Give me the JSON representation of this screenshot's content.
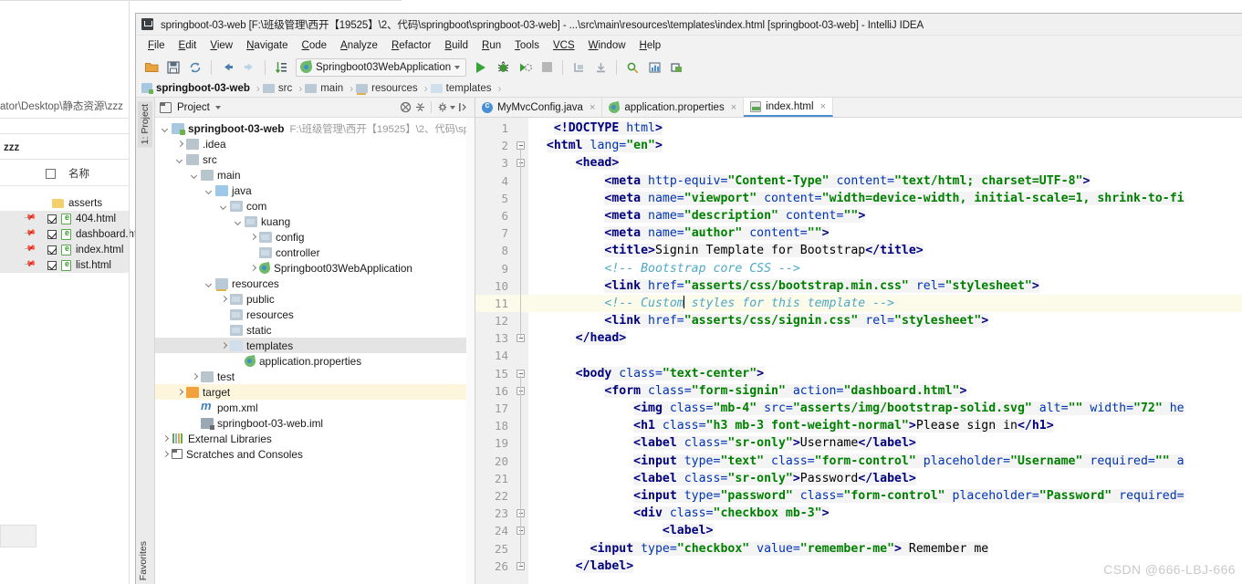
{
  "explorer": {
    "path": "ator\\Desktop\\静态资源\\zzz",
    "folder_label": "zzz",
    "column_header": "名称",
    "rows": [
      {
        "name": "asserts",
        "type": "folder",
        "checked": false,
        "selected": false
      },
      {
        "name": "404.html",
        "type": "html",
        "checked": true,
        "selected": true
      },
      {
        "name": "dashboard.ht",
        "type": "html",
        "checked": true,
        "selected": true
      },
      {
        "name": "index.html",
        "type": "html",
        "checked": true,
        "selected": true
      },
      {
        "name": "list.html",
        "type": "html",
        "checked": true,
        "selected": true
      }
    ]
  },
  "window": {
    "title": "springboot-03-web [F:\\班级管理\\西开【19525】\\2、代码\\springboot\\springboot-03-web] - ...\\src\\main\\resources\\templates\\index.html [springboot-03-web] - IntelliJ IDEA",
    "app_icon": "idea-logo-icon"
  },
  "menu": {
    "items": [
      {
        "m": "F",
        "rest": "ile"
      },
      {
        "m": "E",
        "rest": "dit"
      },
      {
        "m": "V",
        "rest": "iew"
      },
      {
        "m": "N",
        "rest": "avigate"
      },
      {
        "m": "C",
        "rest": "ode"
      },
      {
        "m": "A",
        "rest": "nalyze"
      },
      {
        "m": "R",
        "rest": "efactor"
      },
      {
        "m": "B",
        "rest": "uild"
      },
      {
        "m": "R",
        "rest": "un"
      },
      {
        "m": "T",
        "rest": "ools"
      },
      {
        "m": "VCS",
        "rest": ""
      },
      {
        "m": "W",
        "rest": "indow"
      },
      {
        "m": "H",
        "rest": "elp"
      }
    ]
  },
  "toolbar": {
    "run_config": "Springboot03WebApplication",
    "icons": [
      "open-folder-icon",
      "save-all-icon",
      "sync-icon",
      "back-arrow-icon",
      "forward-arrow-icon",
      "sort-icon",
      "run-icon",
      "debug-icon",
      "run-coverage-icon",
      "stop-icon",
      "build-project-icon",
      "build-module-icon",
      "search-everywhere-icon",
      "settings-icon",
      "sdk-manager-icon"
    ]
  },
  "breadcrumb": {
    "items": [
      {
        "label": "springboot-03-web",
        "icon": "module-icon"
      },
      {
        "label": "src",
        "icon": "folder-icon"
      },
      {
        "label": "main",
        "icon": "folder-icon"
      },
      {
        "label": "resources",
        "icon": "resources-folder-icon"
      },
      {
        "label": "templates",
        "icon": "templates-folder-icon"
      }
    ]
  },
  "left_rail": {
    "top_label": "1: Project",
    "bottom_label": "Favorites"
  },
  "project_panel": {
    "title": "Project",
    "buttons": [
      "collapse-all-icon",
      "expand-icon",
      "settings-gear-icon",
      "hide-panel-icon"
    ],
    "tree": [
      {
        "indent": 0,
        "arrow": "down",
        "icon": "module-root-icon",
        "name": "springboot-03-web",
        "bold": true,
        "path": "F:\\班级管理\\西开【19525】\\2、代码\\springboot"
      },
      {
        "indent": 1,
        "arrow": "right",
        "icon": "folder-grey-icon",
        "name": ".idea"
      },
      {
        "indent": 1,
        "arrow": "down",
        "icon": "folder-grey-icon",
        "name": "src"
      },
      {
        "indent": 2,
        "arrow": "down",
        "icon": "folder-grey-icon",
        "name": "main"
      },
      {
        "indent": 3,
        "arrow": "down",
        "icon": "source-folder-icon",
        "name": "java"
      },
      {
        "indent": 4,
        "arrow": "down",
        "icon": "package-icon",
        "name": "com"
      },
      {
        "indent": 5,
        "arrow": "down",
        "icon": "package-icon",
        "name": "kuang"
      },
      {
        "indent": 6,
        "arrow": "right",
        "icon": "package-icon",
        "name": "config"
      },
      {
        "indent": 6,
        "arrow": "none",
        "icon": "package-icon",
        "name": "controller"
      },
      {
        "indent": 6,
        "arrow": "right",
        "icon": "spring-class-icon",
        "name": "Springboot03WebApplication"
      },
      {
        "indent": 3,
        "arrow": "down",
        "icon": "resources-folder-icon",
        "name": "resources"
      },
      {
        "indent": 4,
        "arrow": "right",
        "icon": "package-icon",
        "name": "public"
      },
      {
        "indent": 4,
        "arrow": "none",
        "icon": "package-icon",
        "name": "resources"
      },
      {
        "indent": 4,
        "arrow": "none",
        "icon": "package-icon",
        "name": "static"
      },
      {
        "indent": 4,
        "arrow": "right",
        "icon": "templates-folder-icon",
        "name": "templates",
        "state": "selected"
      },
      {
        "indent": 5,
        "arrow": "none",
        "icon": "spring-props-icon",
        "name": "application.properties"
      },
      {
        "indent": 2,
        "arrow": "right",
        "icon": "folder-grey-icon",
        "name": "test"
      },
      {
        "indent": 1,
        "arrow": "right",
        "icon": "folder-orange-icon",
        "name": "target",
        "state": "highlighted"
      },
      {
        "indent": 2,
        "arrow": "none",
        "icon": "maven-icon",
        "name": "pom.xml"
      },
      {
        "indent": 2,
        "arrow": "none",
        "icon": "iml-icon",
        "name": "springboot-03-web.iml"
      },
      {
        "indent": 0,
        "arrow": "right",
        "icon": "libraries-icon",
        "name": "External Libraries"
      },
      {
        "indent": 0,
        "arrow": "right",
        "icon": "scratches-icon",
        "name": "Scratches and Consoles"
      }
    ]
  },
  "editor": {
    "tabs": [
      {
        "label": "MyMvcConfig.java",
        "icon": "java-class-icon",
        "active": false
      },
      {
        "label": "application.properties",
        "icon": "spring-props-icon",
        "active": false
      },
      {
        "label": "index.html",
        "icon": "html-file-icon",
        "active": true
      }
    ],
    "caret_line": 11,
    "first_line": 1,
    "last_line": 26,
    "fold_lines": [
      2,
      3,
      13,
      15,
      16,
      23,
      24,
      26
    ],
    "lines": [
      {
        "n": 1,
        "tokens": [
          {
            "t": "ind",
            "v": "   "
          },
          {
            "t": "tg",
            "v": "<!DOCTYPE "
          },
          {
            "t": "at",
            "v": "html"
          },
          {
            "t": "tg",
            "v": ">"
          }
        ]
      },
      {
        "n": 2,
        "tokens": [
          {
            "t": "ind",
            "v": "  "
          },
          {
            "t": "tg",
            "v": "<html "
          },
          {
            "t": "at",
            "v": "lang="
          },
          {
            "t": "vl",
            "v": "\"en\""
          },
          {
            "t": "tg",
            "v": ">"
          }
        ]
      },
      {
        "n": 3,
        "tokens": [
          {
            "t": "ind",
            "v": "      "
          },
          {
            "t": "tg",
            "v": "<head>"
          }
        ]
      },
      {
        "n": 4,
        "tokens": [
          {
            "t": "ind",
            "v": "          "
          },
          {
            "t": "tg",
            "v": "<meta "
          },
          {
            "t": "at",
            "v": "http-equiv="
          },
          {
            "t": "vl",
            "v": "\"Content-Type\""
          },
          {
            "t": "at",
            "v": " content="
          },
          {
            "t": "vl",
            "v": "\"text/html; charset=UTF-8\""
          },
          {
            "t": "tg",
            "v": ">"
          }
        ]
      },
      {
        "n": 5,
        "tokens": [
          {
            "t": "ind",
            "v": "          "
          },
          {
            "t": "tg",
            "v": "<meta "
          },
          {
            "t": "at",
            "v": "name="
          },
          {
            "t": "vl",
            "v": "\"viewport\""
          },
          {
            "t": "at",
            "v": " content="
          },
          {
            "t": "vl",
            "v": "\"width=device-width, initial-scale=1, shrink-to-fi"
          }
        ]
      },
      {
        "n": 6,
        "tokens": [
          {
            "t": "ind",
            "v": "          "
          },
          {
            "t": "tg",
            "v": "<meta "
          },
          {
            "t": "at",
            "v": "name="
          },
          {
            "t": "vl",
            "v": "\"description\""
          },
          {
            "t": "at",
            "v": " content="
          },
          {
            "t": "vl",
            "v": "\"\""
          },
          {
            "t": "tg",
            "v": ">"
          }
        ]
      },
      {
        "n": 7,
        "tokens": [
          {
            "t": "ind",
            "v": "          "
          },
          {
            "t": "tg",
            "v": "<meta "
          },
          {
            "t": "at",
            "v": "name="
          },
          {
            "t": "vl",
            "v": "\"author\""
          },
          {
            "t": "at",
            "v": " content="
          },
          {
            "t": "vl",
            "v": "\"\""
          },
          {
            "t": "tg",
            "v": ">"
          }
        ]
      },
      {
        "n": 8,
        "tokens": [
          {
            "t": "ind",
            "v": "          "
          },
          {
            "t": "tg",
            "v": "<title>"
          },
          {
            "t": "tx",
            "v": "Signin Template for Bootstrap"
          },
          {
            "t": "tg",
            "v": "</title>"
          }
        ]
      },
      {
        "n": 9,
        "tokens": [
          {
            "t": "ind",
            "v": "          "
          },
          {
            "t": "cm",
            "v": "<!-- Bootstrap core CSS -->"
          }
        ]
      },
      {
        "n": 10,
        "tokens": [
          {
            "t": "ind",
            "v": "          "
          },
          {
            "t": "tg",
            "v": "<link "
          },
          {
            "t": "at",
            "v": "href="
          },
          {
            "t": "vl",
            "v": "\"asserts/css/bootstrap.min.css\""
          },
          {
            "t": "at",
            "v": " rel="
          },
          {
            "t": "vl",
            "v": "\"stylesheet\""
          },
          {
            "t": "tg",
            "v": ">"
          }
        ]
      },
      {
        "n": 11,
        "tokens": [
          {
            "t": "ind",
            "v": "          "
          },
          {
            "t": "cm",
            "v": "<!-- Custom"
          },
          {
            "t": "caret",
            "v": ""
          },
          {
            "t": "cm",
            "v": " styles for this template -->"
          }
        ]
      },
      {
        "n": 12,
        "tokens": [
          {
            "t": "ind",
            "v": "          "
          },
          {
            "t": "tg",
            "v": "<link "
          },
          {
            "t": "at",
            "v": "href="
          },
          {
            "t": "vl",
            "v": "\"asserts/css/signin.css\""
          },
          {
            "t": "at",
            "v": " rel="
          },
          {
            "t": "vl",
            "v": "\"stylesheet\""
          },
          {
            "t": "tg",
            "v": ">"
          }
        ]
      },
      {
        "n": 13,
        "tokens": [
          {
            "t": "ind",
            "v": "      "
          },
          {
            "t": "tg",
            "v": "</head>"
          }
        ]
      },
      {
        "n": 14,
        "tokens": []
      },
      {
        "n": 15,
        "tokens": [
          {
            "t": "ind",
            "v": "      "
          },
          {
            "t": "tg",
            "v": "<body "
          },
          {
            "t": "at",
            "v": "class="
          },
          {
            "t": "vl",
            "v": "\"text-center\""
          },
          {
            "t": "tg",
            "v": ">"
          }
        ]
      },
      {
        "n": 16,
        "tokens": [
          {
            "t": "ind",
            "v": "          "
          },
          {
            "t": "tg",
            "v": "<form "
          },
          {
            "t": "at",
            "v": "class="
          },
          {
            "t": "vl",
            "v": "\"form-signin\""
          },
          {
            "t": "at",
            "v": " action="
          },
          {
            "t": "vl",
            "v": "\"dashboard.html\""
          },
          {
            "t": "tg",
            "v": ">"
          }
        ]
      },
      {
        "n": 17,
        "tokens": [
          {
            "t": "ind",
            "v": "              "
          },
          {
            "t": "tg",
            "v": "<img "
          },
          {
            "t": "at",
            "v": "class="
          },
          {
            "t": "vl",
            "v": "\"mb-4\""
          },
          {
            "t": "at",
            "v": " src="
          },
          {
            "t": "vl",
            "v": "\"asserts/img/bootstrap-solid.svg\""
          },
          {
            "t": "at",
            "v": " alt="
          },
          {
            "t": "vl",
            "v": "\"\""
          },
          {
            "t": "at",
            "v": " width="
          },
          {
            "t": "vl",
            "v": "\"72\""
          },
          {
            "t": "at",
            "v": " he"
          }
        ]
      },
      {
        "n": 18,
        "tokens": [
          {
            "t": "ind",
            "v": "              "
          },
          {
            "t": "tg",
            "v": "<h1 "
          },
          {
            "t": "at",
            "v": "class="
          },
          {
            "t": "vl",
            "v": "\"h3 mb-3 font-weight-normal\""
          },
          {
            "t": "tg",
            "v": ">"
          },
          {
            "t": "tx",
            "v": "Please sign in"
          },
          {
            "t": "tg",
            "v": "</h1>"
          }
        ]
      },
      {
        "n": 19,
        "tokens": [
          {
            "t": "ind",
            "v": "              "
          },
          {
            "t": "tg",
            "v": "<label "
          },
          {
            "t": "at",
            "v": "class="
          },
          {
            "t": "vl",
            "v": "\"sr-only\""
          },
          {
            "t": "tg",
            "v": ">"
          },
          {
            "t": "tx",
            "v": "Username"
          },
          {
            "t": "tg",
            "v": "</label>"
          }
        ]
      },
      {
        "n": 20,
        "tokens": [
          {
            "t": "ind",
            "v": "              "
          },
          {
            "t": "tg",
            "v": "<input "
          },
          {
            "t": "at",
            "v": "type="
          },
          {
            "t": "vl",
            "v": "\"text\""
          },
          {
            "t": "at",
            "v": " class="
          },
          {
            "t": "vl",
            "v": "\"form-control\""
          },
          {
            "t": "at",
            "v": " placeholder="
          },
          {
            "t": "vl",
            "v": "\"Username\""
          },
          {
            "t": "at",
            "v": " required="
          },
          {
            "t": "vl",
            "v": "\"\""
          },
          {
            "t": "at",
            "v": " a"
          }
        ]
      },
      {
        "n": 21,
        "tokens": [
          {
            "t": "ind",
            "v": "              "
          },
          {
            "t": "tg",
            "v": "<label "
          },
          {
            "t": "at",
            "v": "class="
          },
          {
            "t": "vl",
            "v": "\"sr-only\""
          },
          {
            "t": "tg",
            "v": ">"
          },
          {
            "t": "tx",
            "v": "Password"
          },
          {
            "t": "tg",
            "v": "</label>"
          }
        ]
      },
      {
        "n": 22,
        "tokens": [
          {
            "t": "ind",
            "v": "              "
          },
          {
            "t": "tg",
            "v": "<input "
          },
          {
            "t": "at",
            "v": "type="
          },
          {
            "t": "vl",
            "v": "\"password\""
          },
          {
            "t": "at",
            "v": " class="
          },
          {
            "t": "vl",
            "v": "\"form-control\""
          },
          {
            "t": "at",
            "v": " placeholder="
          },
          {
            "t": "vl",
            "v": "\"Password\""
          },
          {
            "t": "at",
            "v": " required="
          }
        ]
      },
      {
        "n": 23,
        "tokens": [
          {
            "t": "ind",
            "v": "              "
          },
          {
            "t": "tg",
            "v": "<div "
          },
          {
            "t": "at",
            "v": "class="
          },
          {
            "t": "vl",
            "v": "\"checkbox mb-3\""
          },
          {
            "t": "tg",
            "v": ">"
          }
        ]
      },
      {
        "n": 24,
        "tokens": [
          {
            "t": "ind",
            "v": "                  "
          },
          {
            "t": "tg",
            "v": "<label>"
          }
        ]
      },
      {
        "n": 25,
        "tokens": [
          {
            "t": "ind",
            "v": "        "
          },
          {
            "t": "tg",
            "v": "<input "
          },
          {
            "t": "at",
            "v": "type="
          },
          {
            "t": "vl",
            "v": "\"checkbox\""
          },
          {
            "t": "at",
            "v": " value="
          },
          {
            "t": "vl",
            "v": "\"remember-me\""
          },
          {
            "t": "tg",
            "v": ">"
          },
          {
            "t": "tx",
            "v": " Remember me"
          }
        ]
      },
      {
        "n": 26,
        "tokens": [
          {
            "t": "ind",
            "v": "      "
          },
          {
            "t": "tg",
            "v": "</label>"
          }
        ]
      }
    ]
  },
  "watermark": "CSDN @666-LBJ-666",
  "colors": {
    "accent": "#4a8fd4",
    "tag": "#000080",
    "attr": "#0033b3",
    "value": "#008000",
    "comment": "#4fa8c9",
    "caret_line": "#fcfae8",
    "tree_highlight": "#fdf6dd",
    "tree_selected": "#e4e4e4"
  }
}
